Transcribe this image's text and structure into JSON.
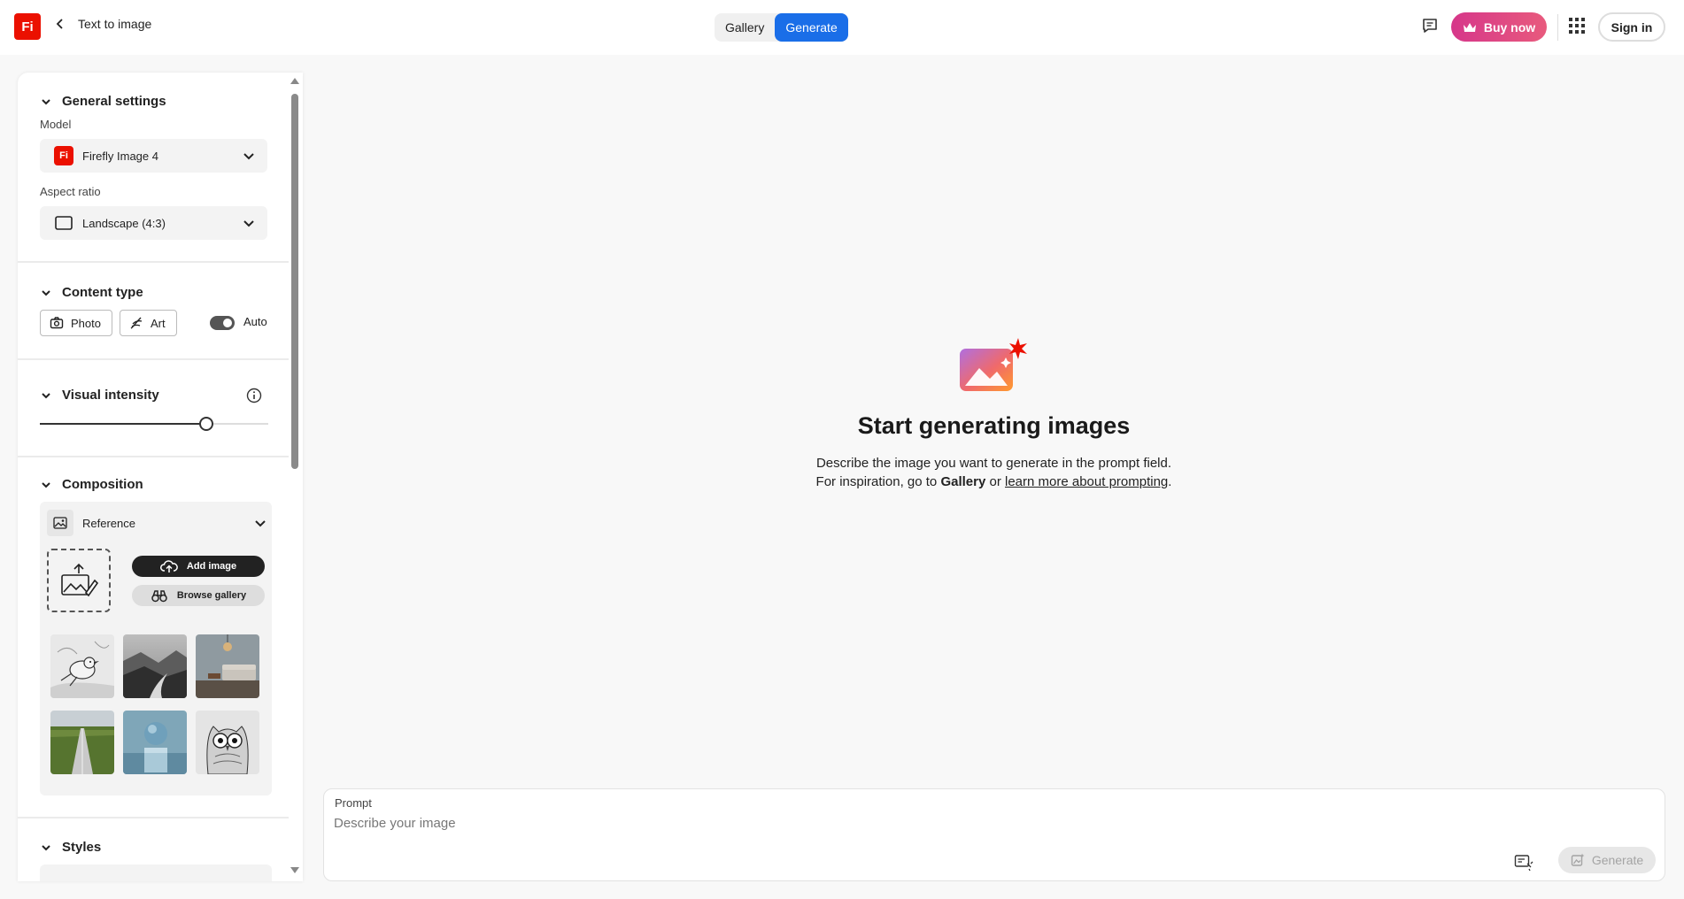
{
  "header": {
    "logo_text": "Fi",
    "back_label": "Text to image",
    "tabs": [
      {
        "label": "Gallery",
        "active": false
      },
      {
        "label": "Generate",
        "active": true
      }
    ],
    "buy_now_label": "Buy now",
    "sign_in_label": "Sign in"
  },
  "sidebar": {
    "general": {
      "title": "General settings",
      "model_label": "Model",
      "model_value": "Firefly Image 4",
      "model_icon_text": "Fi",
      "aspect_label": "Aspect ratio",
      "aspect_value": "Landscape (4:3)"
    },
    "content_type": {
      "title": "Content type",
      "photo_label": "Photo",
      "art_label": "Art",
      "auto_label": "Auto",
      "auto_on": true
    },
    "visual_intensity": {
      "title": "Visual intensity",
      "value_fraction": 0.73
    },
    "composition": {
      "title": "Composition",
      "reference_label": "Reference",
      "add_image_label": "Add image",
      "browse_gallery_label": "Browse gallery",
      "thumbnails": [
        "bird-sketch",
        "misty-river-valley",
        "living-room-interior",
        "green-field-road",
        "blue-sphere-on-block",
        "owl-sketch"
      ]
    },
    "styles": {
      "title": "Styles"
    }
  },
  "main": {
    "title": "Start generating images",
    "line1": "Describe the image you want to generate in the prompt field.",
    "line2_prefix": "For inspiration, go to ",
    "line2_gallery": "Gallery",
    "line2_mid": " or ",
    "line2_link": "learn more about prompting",
    "line2_suffix": "."
  },
  "prompt": {
    "label": "Prompt",
    "placeholder": "Describe your image",
    "value": "",
    "generate_label": "Generate"
  },
  "colors": {
    "brand": "#eb1000",
    "accent": "#1a6ee8",
    "buy_gradient_start": "#d6378a"
  }
}
